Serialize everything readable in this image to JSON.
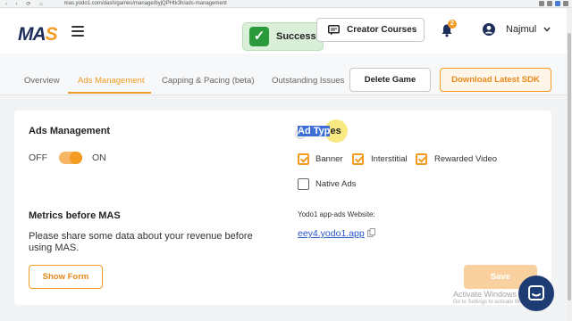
{
  "browser": {
    "url": "mas.yodo1.com/dash/games/manage/byjQPHtk3h/ads-management"
  },
  "header": {
    "logo_part1": "MA",
    "logo_part2": "S",
    "toast_text": "Success",
    "creator_courses_label": "Creator Courses",
    "notification_count": "2",
    "user_name": "Najmul"
  },
  "tabs": [
    {
      "label": "Overview"
    },
    {
      "label": "Ads Management",
      "active": true
    },
    {
      "label": "Capping & Pacing (beta)"
    },
    {
      "label": "Outstanding Issues"
    }
  ],
  "actions": {
    "delete_label": "Delete Game",
    "sdk_label": "Download Latest SDK"
  },
  "ads_management": {
    "title": "Ads Management",
    "off_label": "OFF",
    "on_label": "ON",
    "enabled": true
  },
  "ad_types": {
    "title_selected": "Ad Typ",
    "title_rest": "es",
    "options": [
      {
        "label": "Banner",
        "checked": true
      },
      {
        "label": "Interstitial",
        "checked": true
      },
      {
        "label": "Rewarded Video",
        "checked": true
      },
      {
        "label": "Native Ads",
        "checked": false
      }
    ]
  },
  "metrics": {
    "title": "Metrics before MAS",
    "description": "Please share some data about your revenue before using MAS.",
    "show_form_label": "Show Form"
  },
  "website": {
    "label": "Yodo1 app-ads Website:",
    "link": "eey4.yodo1.app"
  },
  "save_label": "Save",
  "watermark": {
    "line1": "Activate Windows",
    "line2": "Go to Settings to activate Windows."
  },
  "colors": {
    "accent": "#f39b23",
    "navy": "#1f2d5a",
    "success": "#2a9a3a",
    "link": "#2855c8"
  }
}
